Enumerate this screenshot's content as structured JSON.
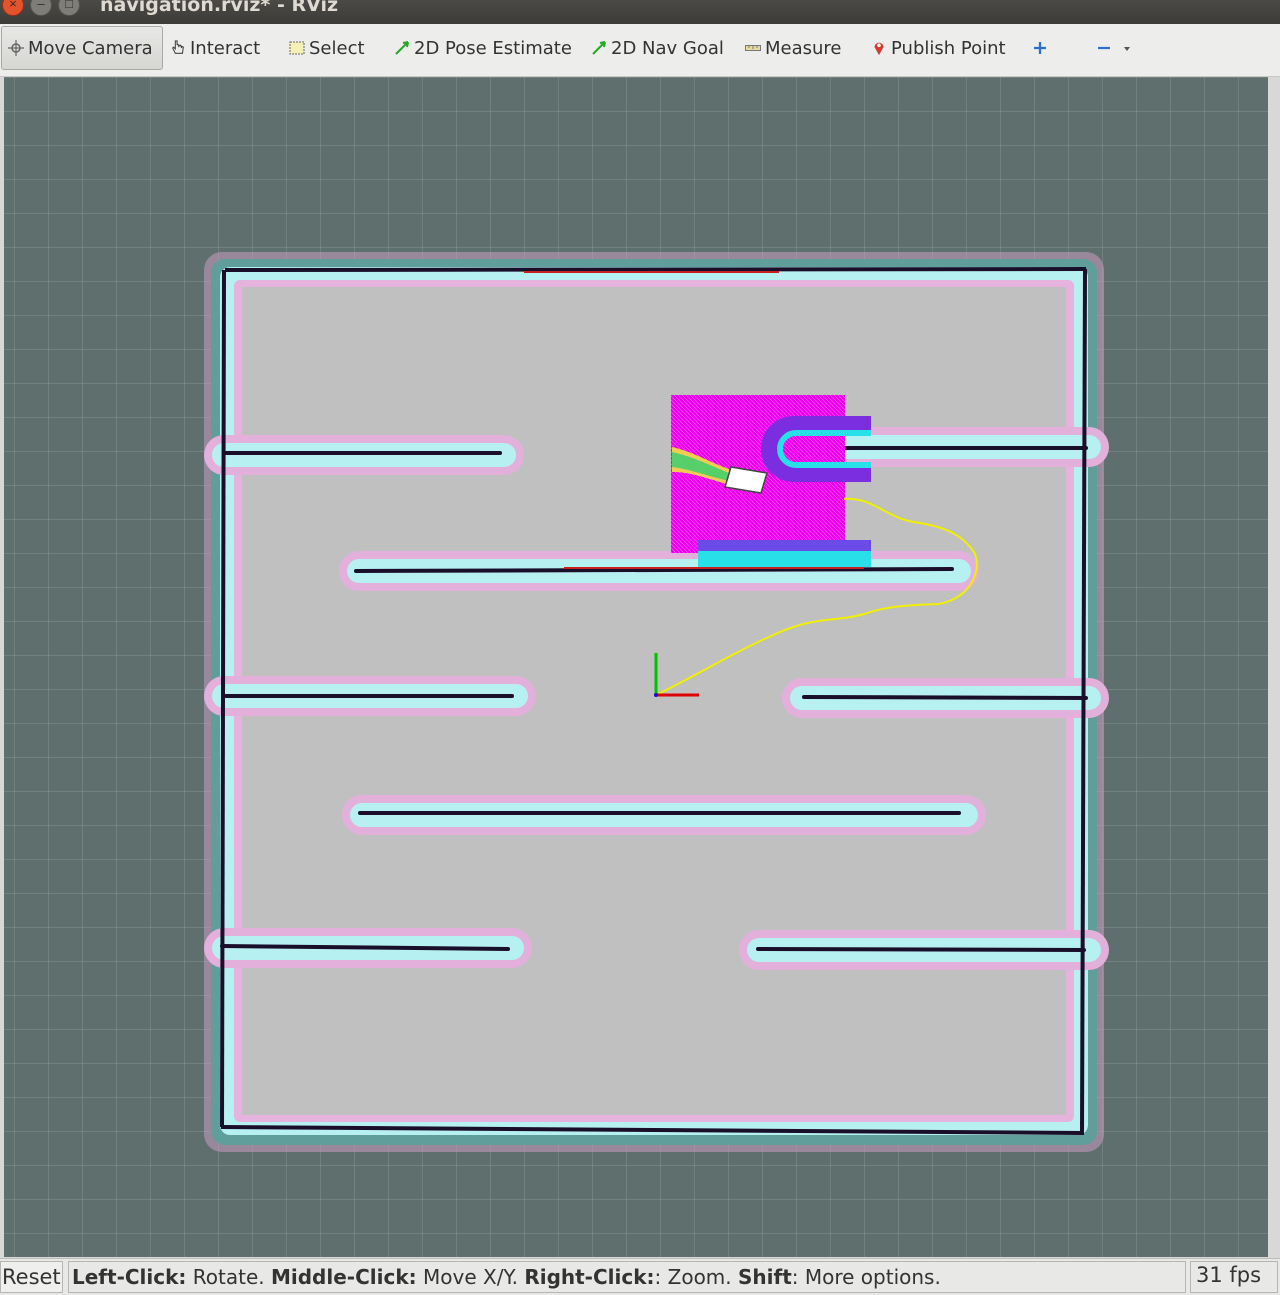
{
  "window": {
    "title": "navigation.rviz* - RViz",
    "close_glyph": "×",
    "min_glyph": "–",
    "max_glyph": "□"
  },
  "toolbar": {
    "tools": [
      {
        "id": "move_camera",
        "label": "Move Camera",
        "icon": "move-camera-icon",
        "active": true
      },
      {
        "id": "interact",
        "label": "Interact",
        "icon": "hand-pointer-icon"
      },
      {
        "id": "select",
        "label": "Select",
        "icon": "select-box-icon"
      },
      {
        "id": "pose_estimate",
        "label": "2D Pose Estimate",
        "icon": "green-arrow-icon"
      },
      {
        "id": "nav_goal",
        "label": "2D Nav Goal",
        "icon": "green-arrow-icon"
      },
      {
        "id": "measure",
        "label": "Measure",
        "icon": "ruler-icon"
      },
      {
        "id": "publish_point",
        "label": "Publish Point",
        "icon": "map-pin-icon"
      }
    ],
    "add_tool_icon": "plus-icon",
    "remove_tool_icon": "minus-icon",
    "dropdown_icon": "chevron-down-icon"
  },
  "viewport": {
    "colors": {
      "background": "#5f6f6e",
      "grid": "#8a9897",
      "free_space": "#c0c0c0",
      "inflation_outer": "#5f9e9b",
      "inflation_inner": "#b7f0f0",
      "inflation_halo": "#d9a8d0",
      "obstacle": "#1a0f2a",
      "local_costmap": "#ee00ee",
      "global_plan": "#f0f000",
      "robot": "#ffffff",
      "axis_x": "#e00000",
      "axis_y": "#00c000"
    }
  },
  "status": {
    "reset_label": "Reset",
    "left_click_key": "Left-Click:",
    "left_click_action": " Rotate. ",
    "middle_click_key": "Middle-Click:",
    "middle_click_action": " Move X/Y. ",
    "right_click_key": "Right-Click:",
    "right_click_action": ": Zoom. ",
    "shift_key": "Shift",
    "shift_action": ": More options.",
    "fps": "31 fps"
  }
}
